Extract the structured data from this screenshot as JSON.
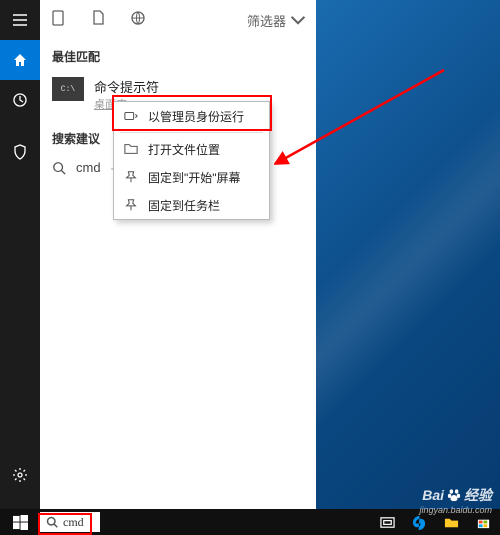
{
  "sidebar": {
    "top": [
      "menu",
      "home",
      "clock",
      "shield"
    ],
    "bottom": [
      "settings",
      "person"
    ]
  },
  "panel": {
    "filter_label": "筛选器",
    "best_match_title": "最佳匹配",
    "app": {
      "icon_text": "C:\\",
      "name": "命令提示符",
      "sub": "桌面应"
    },
    "suggest_title": "搜索建议",
    "suggest_item": "cmd",
    "suggest_suffix": "- 查"
  },
  "context": {
    "items": [
      {
        "icon": "run-as",
        "label": "以管理员身份运行"
      },
      {
        "icon": "folder",
        "label": "打开文件位置"
      },
      {
        "icon": "pin-start",
        "label": "固定到\"开始\"屏幕"
      },
      {
        "icon": "pin-task",
        "label": "固定到任务栏"
      }
    ]
  },
  "taskbar": {
    "search_value": "cmd"
  },
  "watermark": {
    "brand": "Bai",
    "brand2": "经验",
    "url": "jingyan.baidu.com"
  }
}
